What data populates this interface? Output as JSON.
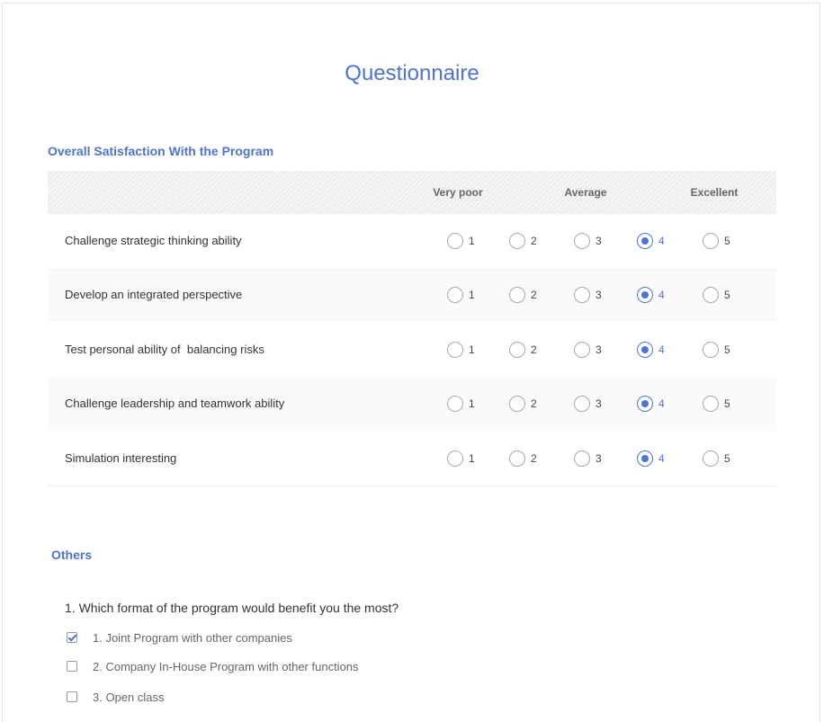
{
  "title": "Questionnaire",
  "colors": {
    "accent": "#4d73d3",
    "text": "#333333",
    "muted": "#666666"
  },
  "satisfaction": {
    "heading": "Overall Satisfaction With the Program",
    "scale_labels": {
      "low": "Very poor",
      "mid": "Average",
      "high": "Excellent"
    },
    "options": [
      "1",
      "2",
      "3",
      "4",
      "5"
    ],
    "rows": [
      {
        "label": "Challenge strategic thinking ability",
        "selected": "4"
      },
      {
        "label": "Develop an integrated perspective",
        "selected": "4"
      },
      {
        "label": "Test personal ability of  balancing risks",
        "selected": "4"
      },
      {
        "label": "Challenge leadership and teamwork ability",
        "selected": "4"
      },
      {
        "label": "Simulation interesting",
        "selected": "4"
      }
    ]
  },
  "others": {
    "heading": "Others",
    "question": "1. Which format of the program would benefit you the most?",
    "choices": [
      {
        "label": "1. Joint Program with other companies",
        "checked": true
      },
      {
        "label": "2. Company In-House Program with other functions",
        "checked": false
      },
      {
        "label": "3. Open class",
        "checked": false
      }
    ]
  }
}
